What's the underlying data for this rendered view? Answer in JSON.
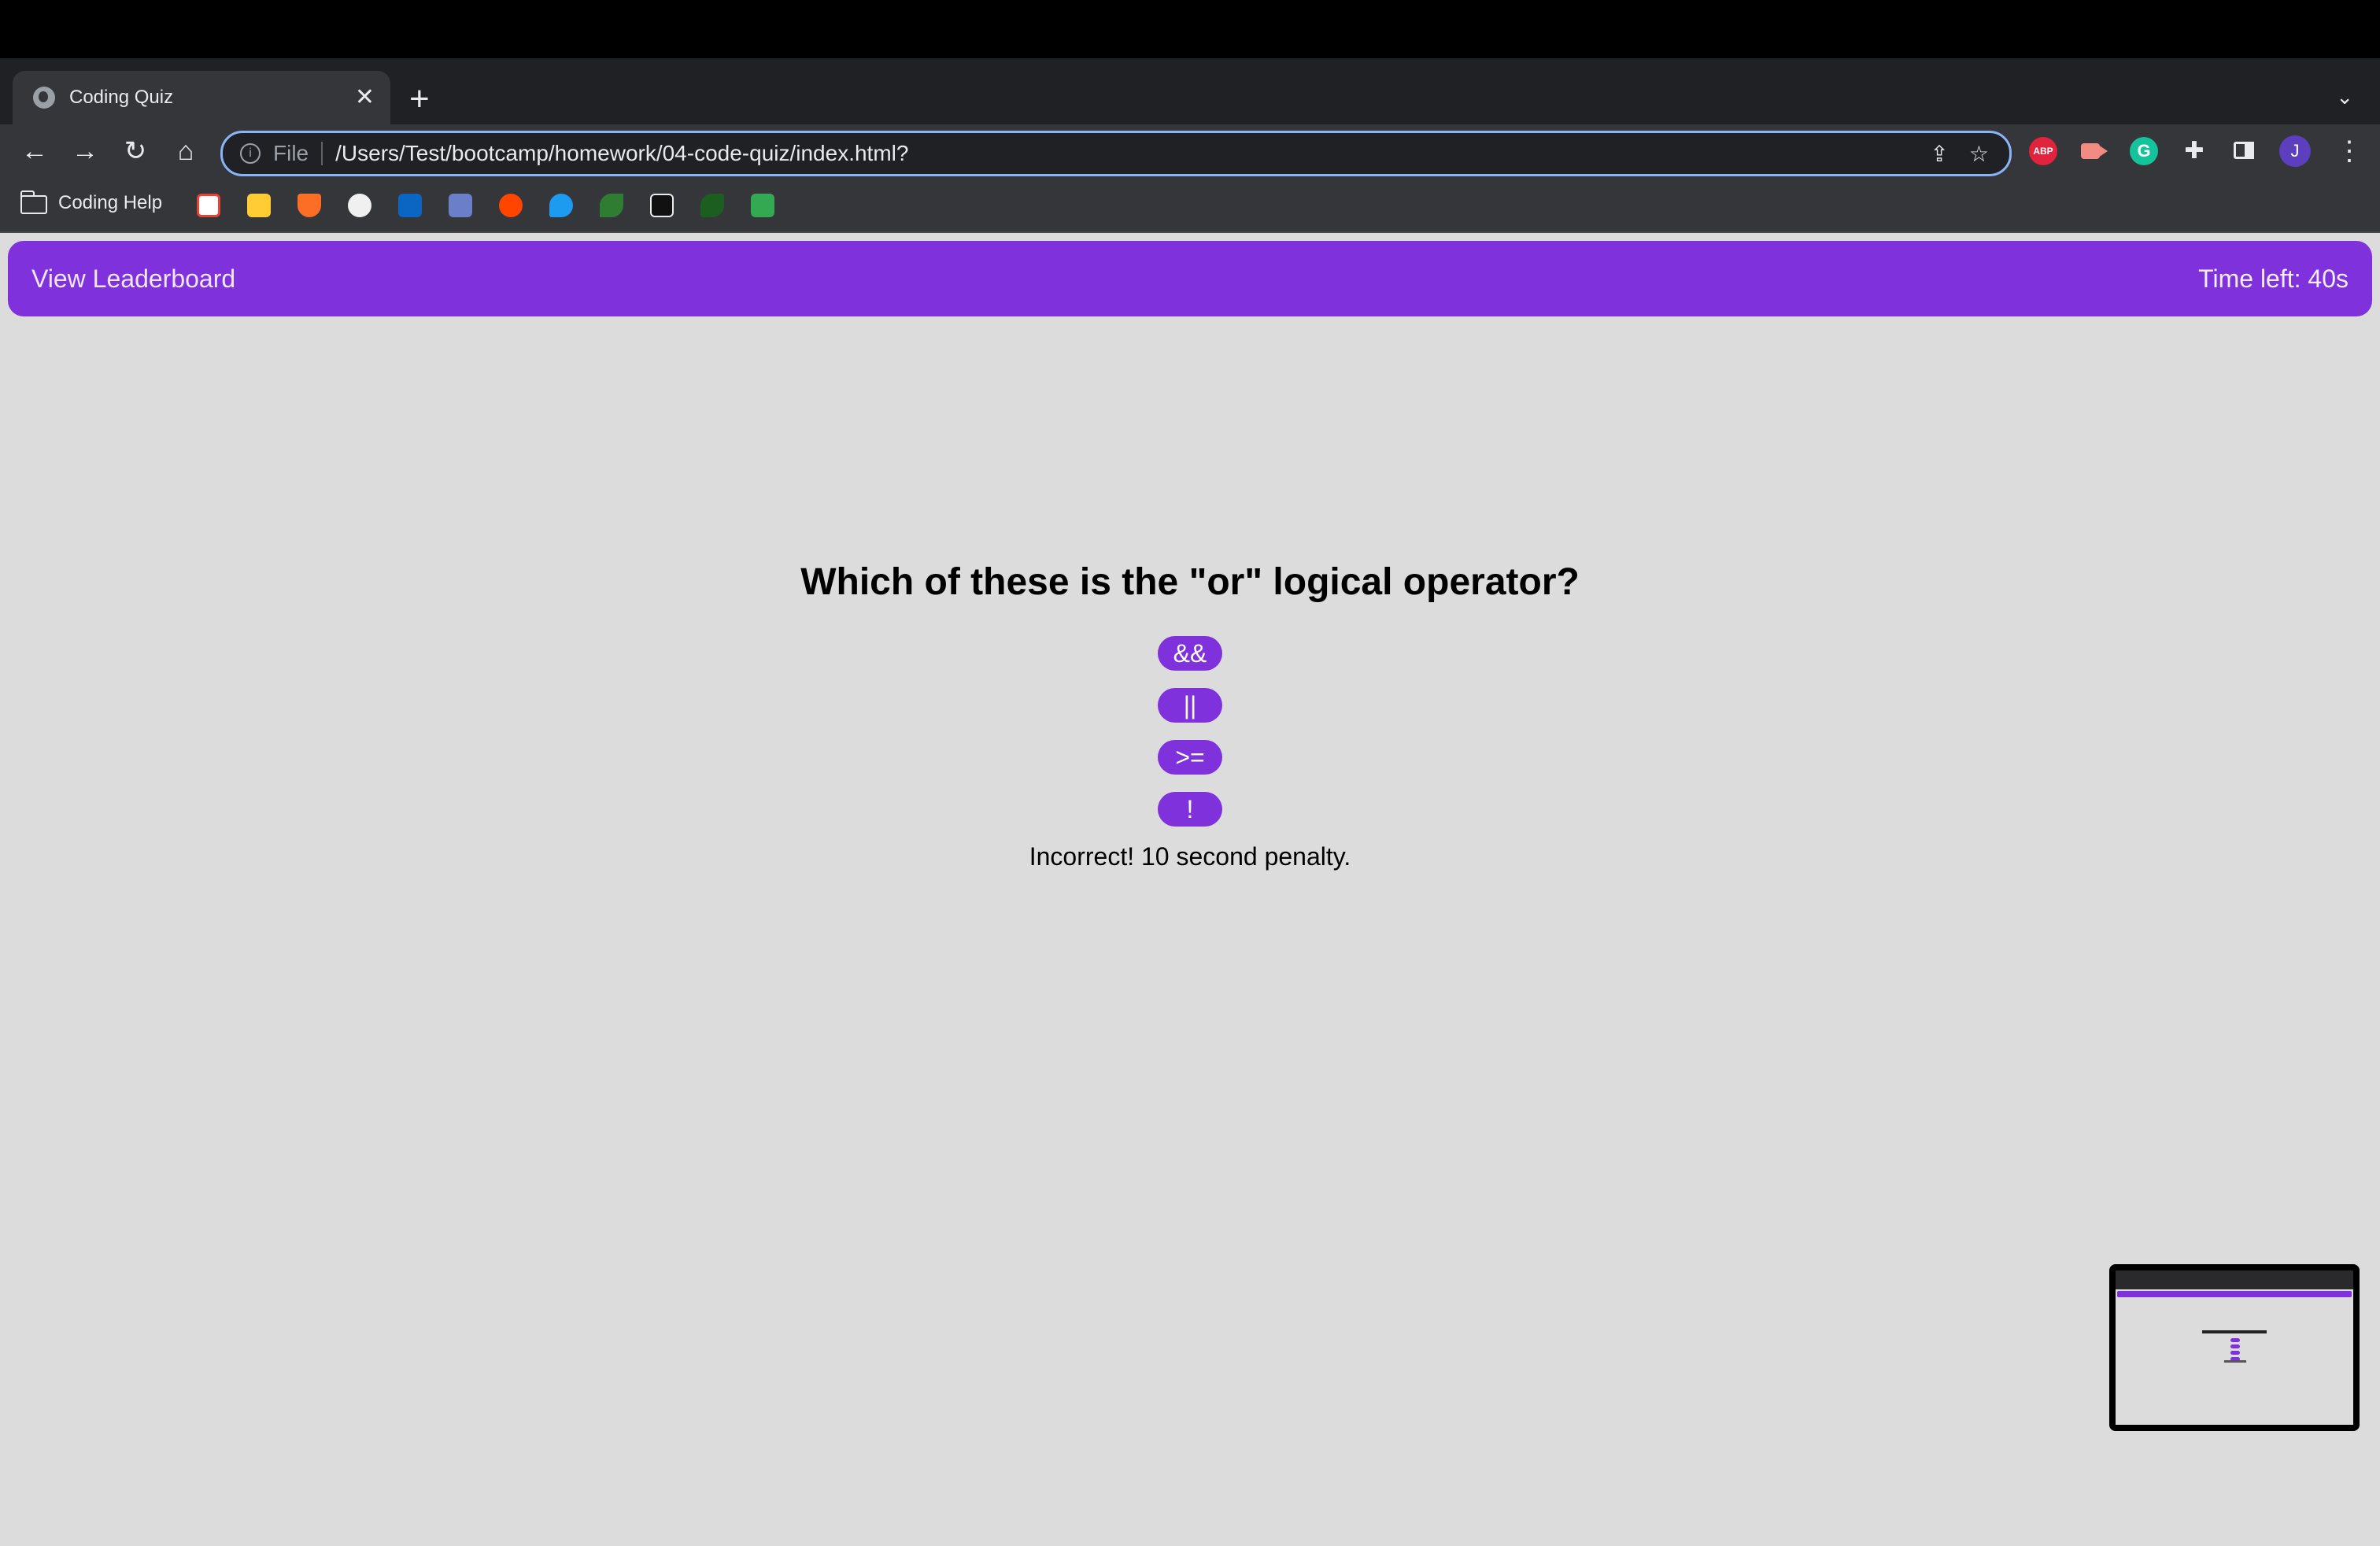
{
  "browser": {
    "tab": {
      "title": "Coding Quiz"
    },
    "address": {
      "scheme_label": "File",
      "url": "/Users/Test/bootcamp/homework/04-code-quiz/index.html?"
    },
    "profile_initial": "J",
    "bookmarks": {
      "folder_label": "Coding Help",
      "items": [
        "gmail-icon",
        "umn-icon",
        "gitlab-icon",
        "github-icon",
        "linkedin-icon",
        "bookmark-site-icon",
        "reddit-icon",
        "twitter-icon",
        "leaf-icon",
        "a-icon",
        "whale-icon",
        "sheets-icon"
      ]
    },
    "extensions": {
      "adblock_label": "ABP",
      "grammarly_label": "G"
    }
  },
  "quiz": {
    "header": {
      "leaderboard_link": "View Leaderboard",
      "timer": "Time left: 40s"
    },
    "question": "Which of these is the \"or\" logical operator?",
    "answers": [
      "&&",
      "||",
      ">=",
      "!"
    ],
    "feedback": "Incorrect! 10 second penalty."
  },
  "colors": {
    "accent": "#7f31dc",
    "page_background": "#dcdcdc",
    "browser_chrome": "#35363a"
  }
}
